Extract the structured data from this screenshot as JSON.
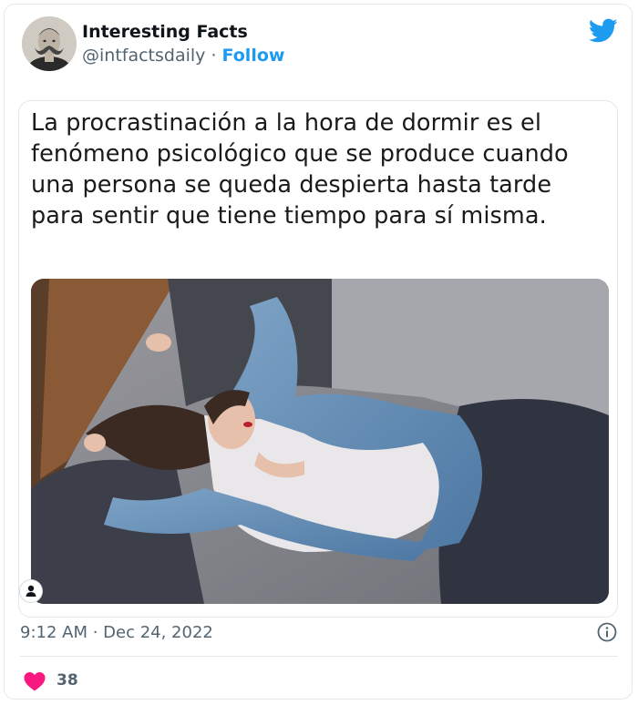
{
  "author": {
    "name": "Interesting Facts",
    "handle": "@intfactsdaily",
    "separator": "·",
    "follow_label": "Follow",
    "avatar_icon": "portrait-avatar"
  },
  "brand": {
    "logo_icon": "twitter-bird-icon",
    "accent_color": "#1d9bf0"
  },
  "tweet": {
    "lines": [
      "La procrastinación a la hora de dormir es el",
      "fenómeno psicológico que se produce cuando",
      "una persona se queda despierta hasta tarde",
      "para sentir que tiene tiempo para sí misma."
    ],
    "image_icon": "photo-woman-on-bed"
  },
  "meta": {
    "timestamp": "9:12 AM · Dec 24, 2022",
    "info_icon": "info-icon"
  },
  "engagement": {
    "like_icon": "heart-icon",
    "like_color": "#f91880",
    "likes": "38"
  }
}
